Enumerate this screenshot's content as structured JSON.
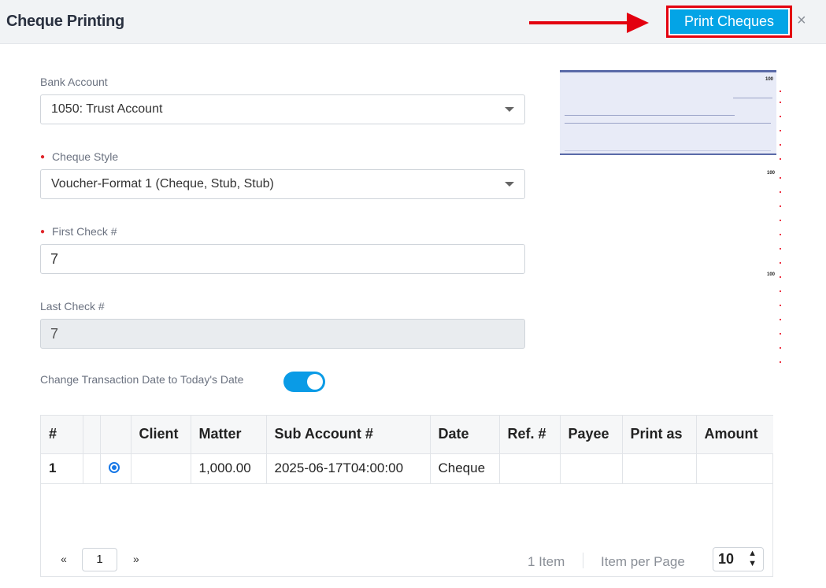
{
  "header": {
    "title": "Cheque Printing",
    "print_label": "Print Cheques",
    "close_label": "×",
    "highlight_color": "#e3000f",
    "accent_color": "#03a4e6"
  },
  "form": {
    "bank_account": {
      "label": "Bank Account",
      "value": "1050: Trust Account"
    },
    "cheque_style": {
      "label": "Cheque Style",
      "value": "Voucher-Format 1 (Cheque, Stub, Stub)",
      "required": true
    },
    "first_check": {
      "label": "First Check #",
      "value": "7",
      "required": true
    },
    "last_check": {
      "label": "Last Check #",
      "value": "7",
      "disabled": true
    },
    "change_date": {
      "label": "Change Transaction Date to Today's Date",
      "enabled": true
    }
  },
  "preview": {
    "cheque_numbers": [
      "100",
      "100",
      "100"
    ]
  },
  "table": {
    "columns": [
      "#",
      "",
      "",
      "Client",
      "Matter",
      "Sub Account #",
      "Date",
      "Ref. #",
      "Payee",
      "Print as",
      "Amount"
    ],
    "rows": [
      {
        "num": "1",
        "selected": true,
        "client": "",
        "matter": "1,000.00",
        "sub_account": "2025-06-17T04:00:00",
        "date": "Cheque",
        "ref": "",
        "payee": "",
        "print_as": "",
        "amount": ""
      }
    ]
  },
  "pagination": {
    "prev": "«",
    "next": "»",
    "page": "1",
    "count": "1 Item",
    "per_page_label": "Item per Page",
    "page_size": "10"
  }
}
